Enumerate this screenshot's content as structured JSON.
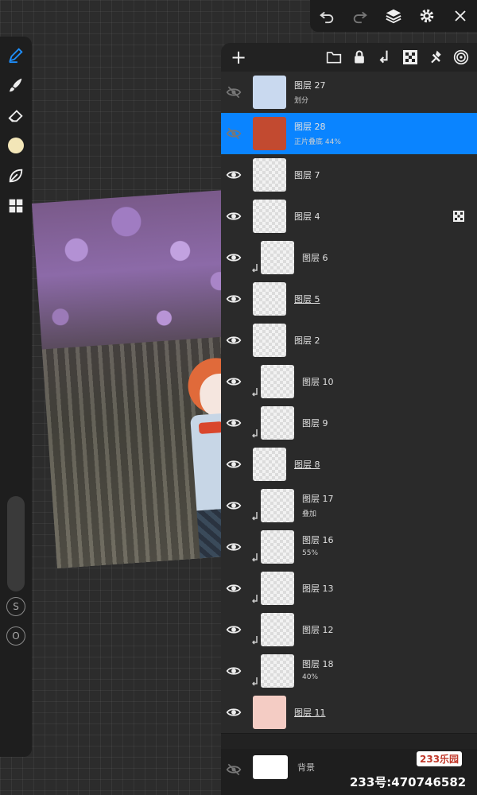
{
  "topbar": {
    "icons": [
      "undo-icon",
      "redo-icon",
      "layers-icon",
      "gear-icon",
      "close-icon"
    ]
  },
  "toolbar": {
    "tools": [
      "pen-icon",
      "brush-icon",
      "eraser-icon",
      "color-swatch",
      "leaf-icon",
      "grid-icon"
    ],
    "color": "#f3e6b8",
    "s_label": "S",
    "o_label": "O"
  },
  "layers_panel": {
    "add_label": "+",
    "header_icons": [
      "folder-icon",
      "lock-icon",
      "merge-down-icon",
      "checker-icon",
      "pin-icon",
      "target-icon"
    ],
    "layers": [
      {
        "name": "图层 27",
        "sub": "划分",
        "visible": false,
        "clipped": false,
        "selected": false
      },
      {
        "name": "图层 28",
        "sub": "正片叠底 44%",
        "visible": false,
        "clipped": false,
        "selected": true
      },
      {
        "name": "图层 7",
        "sub": "",
        "visible": true,
        "clipped": false,
        "selected": false
      },
      {
        "name": "图层 4",
        "sub": "",
        "visible": true,
        "clipped": false,
        "selected": false,
        "mask": true
      },
      {
        "name": "图层 6",
        "sub": "",
        "visible": true,
        "clipped": true,
        "selected": false
      },
      {
        "name": "图层 5",
        "sub": "",
        "visible": true,
        "clipped": false,
        "selected": false,
        "underline": true
      },
      {
        "name": "图层 2",
        "sub": "",
        "visible": true,
        "clipped": false,
        "selected": false
      },
      {
        "name": "图层 10",
        "sub": "",
        "visible": true,
        "clipped": true,
        "selected": false
      },
      {
        "name": "图层 9",
        "sub": "",
        "visible": true,
        "clipped": true,
        "selected": false
      },
      {
        "name": "图层 8",
        "sub": "",
        "visible": true,
        "clipped": false,
        "selected": false,
        "underline": true
      },
      {
        "name": "图层 17",
        "sub": "叠加",
        "visible": true,
        "clipped": true,
        "selected": false
      },
      {
        "name": "图层 16",
        "sub": "55%",
        "visible": true,
        "clipped": true,
        "selected": false
      },
      {
        "name": "图层 13",
        "sub": "",
        "visible": true,
        "clipped": true,
        "selected": false
      },
      {
        "name": "图层 12",
        "sub": "",
        "visible": true,
        "clipped": true,
        "selected": false
      },
      {
        "name": "图层 18",
        "sub": "40%",
        "visible": true,
        "clipped": true,
        "selected": false
      },
      {
        "name": "图层 11",
        "sub": "",
        "visible": true,
        "clipped": false,
        "selected": false,
        "underline": true
      }
    ],
    "background": {
      "name": "背景",
      "visible": false
    }
  },
  "watermark": {
    "logo": "233乐园",
    "id": "233号:470746582"
  }
}
